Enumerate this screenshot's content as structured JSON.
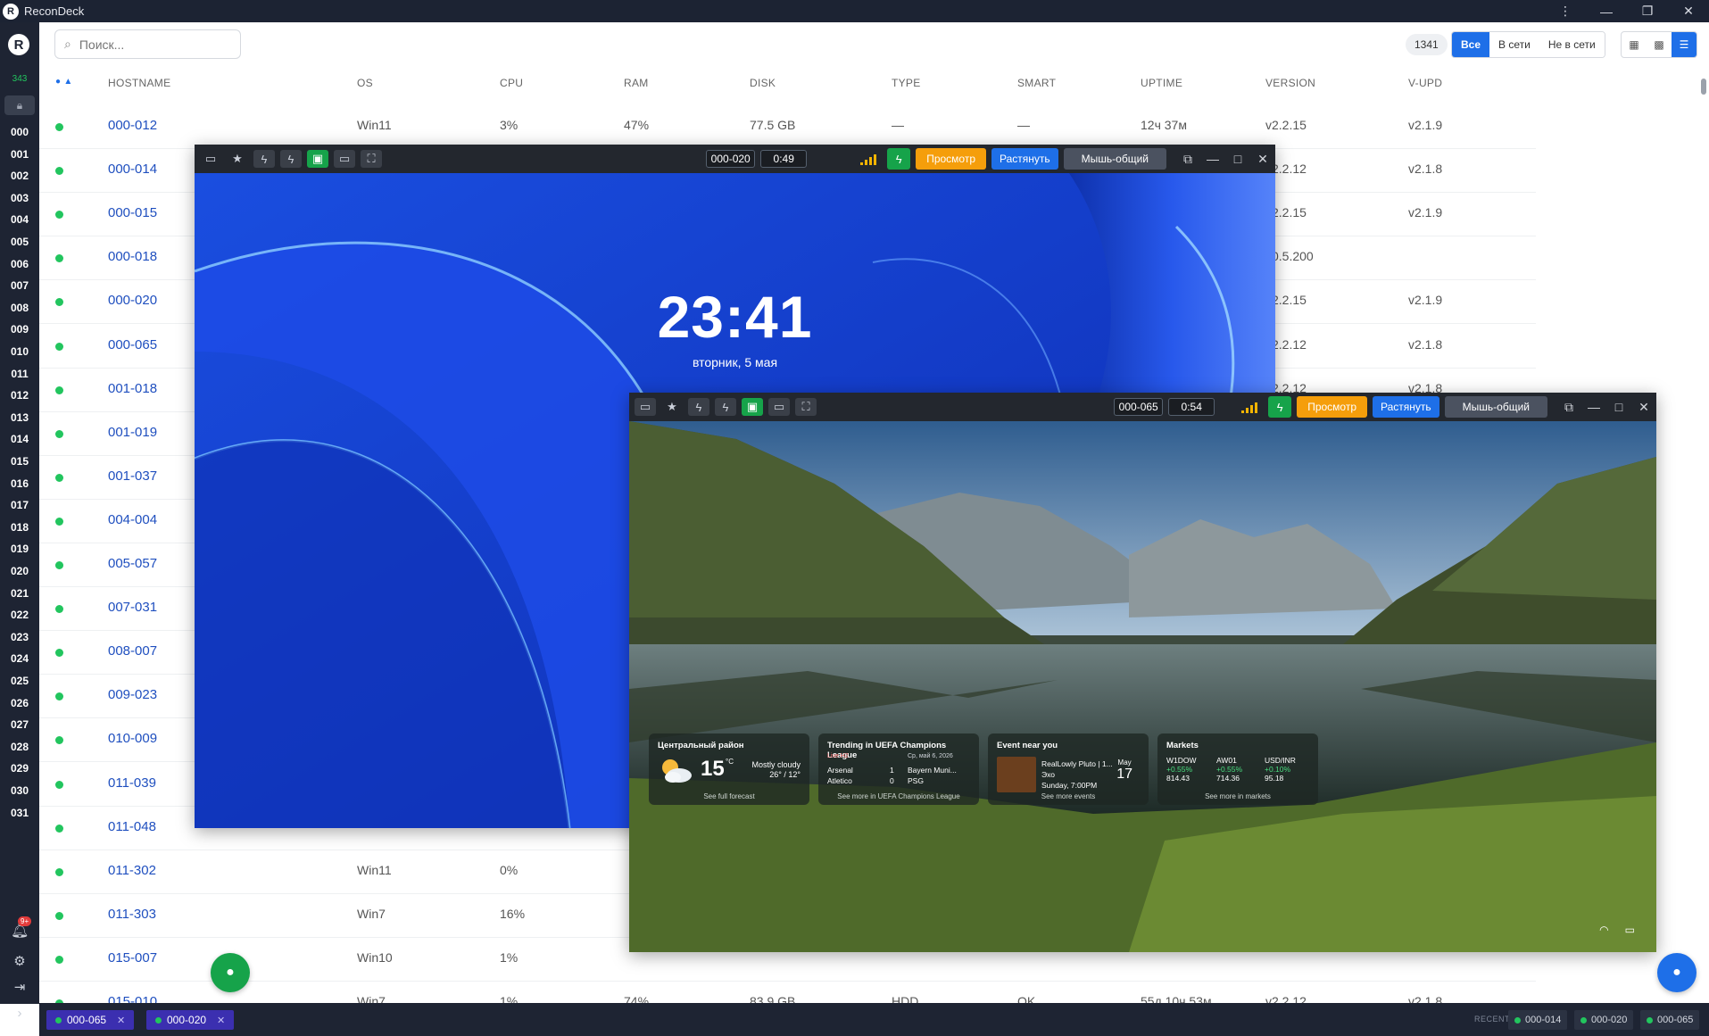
{
  "app": {
    "title": "ReconDeck",
    "logo_letter": "R"
  },
  "rail": {
    "online_count": "343",
    "groups": [
      "000",
      "001",
      "002",
      "003",
      "004",
      "005",
      "006",
      "007",
      "008",
      "009",
      "010",
      "011",
      "012",
      "013",
      "014",
      "015",
      "016",
      "017",
      "018",
      "019",
      "020",
      "021",
      "022",
      "023",
      "024",
      "025",
      "026",
      "027",
      "028",
      "029",
      "030",
      "031"
    ],
    "notification_badge": "9+"
  },
  "toolbar": {
    "search_placeholder": "Поиск...",
    "total": "1341",
    "filters": [
      "Все",
      "В сети",
      "Не в сети"
    ],
    "active_filter": "Все"
  },
  "table": {
    "headers": [
      "HOSTNAME",
      "OS",
      "CPU",
      "RAM",
      "DISK",
      "TYPE",
      "SMART",
      "UPTIME",
      "VERSION",
      "V-UPD"
    ],
    "rows": [
      {
        "host": "000-012",
        "os": "Win11",
        "cpu": "3%",
        "ram": "47%",
        "disk": "77.5 GB",
        "type": "—",
        "smart": "—",
        "uptime": "12ч 37м",
        "version": "v2.2.15",
        "vupd": "v2.1.9"
      },
      {
        "host": "000-014",
        "os": "",
        "cpu": "",
        "ram": "",
        "disk": "",
        "type": "",
        "smart": "",
        "uptime": "",
        "version": "v2.2.12",
        "vupd": "v2.1.8"
      },
      {
        "host": "000-015",
        "os": "",
        "cpu": "",
        "ram": "",
        "disk": "",
        "type": "",
        "smart": "",
        "uptime": "",
        "version": "v2.2.15",
        "vupd": "v2.1.9"
      },
      {
        "host": "000-018",
        "os": "",
        "cpu": "",
        "ram": "",
        "disk": "",
        "type": "",
        "smart": "",
        "uptime": "",
        "version": "v0.5.200",
        "vupd": ""
      },
      {
        "host": "000-020",
        "os": "",
        "cpu": "",
        "ram": "",
        "disk": "",
        "type": "",
        "smart": "",
        "uptime": "",
        "version": "v2.2.15",
        "vupd": "v2.1.9"
      },
      {
        "host": "000-065",
        "os": "",
        "cpu": "",
        "ram": "",
        "disk": "",
        "type": "",
        "smart": "",
        "uptime": "",
        "version": "v2.2.12",
        "vupd": "v2.1.8"
      },
      {
        "host": "001-018",
        "os": "",
        "cpu": "",
        "ram": "",
        "disk": "",
        "type": "",
        "smart": "",
        "uptime": "",
        "version": "v2.2.12",
        "vupd": "v2.1.8"
      },
      {
        "host": "001-019",
        "os": "",
        "cpu": "",
        "ram": "",
        "disk": "",
        "type": "",
        "smart": "",
        "uptime": "",
        "version": "",
        "vupd": ""
      },
      {
        "host": "001-037",
        "os": "",
        "cpu": "",
        "ram": "",
        "disk": "",
        "type": "",
        "smart": "",
        "uptime": "",
        "version": "",
        "vupd": ""
      },
      {
        "host": "004-004",
        "os": "",
        "cpu": "",
        "ram": "",
        "disk": "",
        "type": "",
        "smart": "",
        "uptime": "",
        "version": "",
        "vupd": ""
      },
      {
        "host": "005-057",
        "os": "",
        "cpu": "",
        "ram": "",
        "disk": "",
        "type": "",
        "smart": "",
        "uptime": "",
        "version": "",
        "vupd": ""
      },
      {
        "host": "007-031",
        "os": "",
        "cpu": "",
        "ram": "",
        "disk": "",
        "type": "",
        "smart": "",
        "uptime": "",
        "version": "",
        "vupd": ""
      },
      {
        "host": "008-007",
        "os": "",
        "cpu": "",
        "ram": "",
        "disk": "",
        "type": "",
        "smart": "",
        "uptime": "",
        "version": "",
        "vupd": ""
      },
      {
        "host": "009-023",
        "os": "",
        "cpu": "",
        "ram": "",
        "disk": "",
        "type": "",
        "smart": "",
        "uptime": "",
        "version": "",
        "vupd": ""
      },
      {
        "host": "010-009",
        "os": "",
        "cpu": "",
        "ram": "",
        "disk": "",
        "type": "",
        "smart": "",
        "uptime": "",
        "version": "",
        "vupd": ""
      },
      {
        "host": "011-039",
        "os": "",
        "cpu": "",
        "ram": "",
        "disk": "",
        "type": "",
        "smart": "",
        "uptime": "",
        "version": "",
        "vupd": ""
      },
      {
        "host": "011-048",
        "os": "",
        "cpu": "",
        "ram": "",
        "disk": "",
        "type": "",
        "smart": "",
        "uptime": "",
        "version": "",
        "vupd": ""
      },
      {
        "host": "011-302",
        "os": "Win11",
        "cpu": "0%",
        "ram": "",
        "disk": "",
        "type": "",
        "smart": "",
        "uptime": "",
        "version": "",
        "vupd": ""
      },
      {
        "host": "011-303",
        "os": "Win7",
        "cpu": "16%",
        "ram": "",
        "disk": "",
        "type": "",
        "smart": "",
        "uptime": "",
        "version": "",
        "vupd": ""
      },
      {
        "host": "015-007",
        "os": "Win10",
        "cpu": "1%",
        "ram": "",
        "disk": "",
        "type": "",
        "smart": "",
        "uptime": "",
        "version": "",
        "vupd": ""
      },
      {
        "host": "015-010",
        "os": "Win7",
        "cpu": "1%",
        "ram": "74%",
        "disk": "83.9 GB",
        "type": "HDD",
        "smart": "OK",
        "uptime": "55д 10ч 53м",
        "version": "v2.2.12",
        "vupd": "v2.1.8"
      }
    ]
  },
  "remote1": {
    "host": "000-020",
    "timer": "0:49",
    "btn_view": "Просмотр",
    "btn_stretch": "Растянуть",
    "btn_mouse": "Мышь-общий",
    "clock": "23:41",
    "date": "вторник, 5 мая"
  },
  "remote2": {
    "host": "000-065",
    "timer": "0:54",
    "btn_view": "Просмотр",
    "btn_stretch": "Растянуть",
    "btn_mouse": "Мышь-общий",
    "weather": {
      "title": "Центральный район",
      "temp": "15",
      "unit": "°C",
      "cond": "Mostly cloudy",
      "range": "26° / 12°",
      "more": "See full forecast"
    },
    "sports": {
      "title": "Trending in UEFA Champions League",
      "live": "Live H2",
      "date": "Ср, май 6, 2026",
      "team1": "Arsenal",
      "score1": "1",
      "team2": "Atletico",
      "score2": "0",
      "opp1": "Bayern Muni...",
      "opp2": "PSG",
      "more": "See more in UEFA Champions League"
    },
    "event": {
      "title": "Event near you",
      "name": "RealLowly Pluto | 1...",
      "place": "Эхо",
      "time": "Sunday, 7:00PM",
      "month": "May",
      "day": "17",
      "more": "See more events"
    },
    "markets": {
      "title": "Markets",
      "items": [
        {
          "sym": "W1DOW",
          "chg": "+0.55%",
          "val": "814.43"
        },
        {
          "sym": "AW01",
          "chg": "+0.55%",
          "val": "714.36"
        },
        {
          "sym": "USD/INR",
          "chg": "+0.10%",
          "val": "95.18"
        }
      ],
      "more": "See more in markets"
    }
  },
  "bottom": {
    "tabs": [
      "000-065",
      "000-020"
    ],
    "recent_label": "RECENT",
    "recent": [
      "000-014",
      "000-020",
      "000-065"
    ]
  }
}
